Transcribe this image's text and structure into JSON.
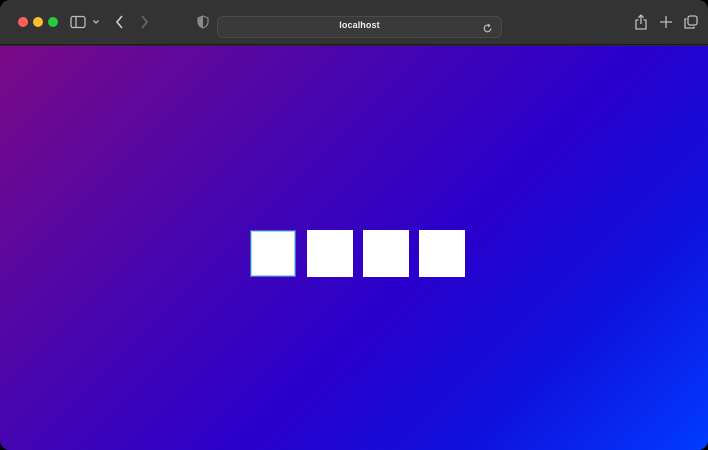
{
  "browser": {
    "url": "localhost",
    "icons": {
      "sidebar": "sidebar-icon",
      "sidebar_menu": "chevron-down-icon",
      "back": "chevron-left-icon",
      "forward": "chevron-right-icon",
      "privacy": "shield-icon",
      "reload": "reload-icon",
      "share": "share-icon",
      "new_tab": "plus-icon",
      "tab_overview": "tabs-icon"
    },
    "traffic_colors": {
      "close": "#fe5f57",
      "minimize": "#febc2e",
      "zoom": "#28c840"
    }
  },
  "page": {
    "background_gradient": [
      "#7a0a86",
      "#2a00cc",
      "#003bff"
    ],
    "tiles": [
      {
        "focused": true,
        "value": ""
      },
      {
        "focused": false,
        "value": ""
      },
      {
        "focused": false,
        "value": ""
      },
      {
        "focused": false,
        "value": ""
      }
    ],
    "focus_color": "#2e74d8"
  }
}
